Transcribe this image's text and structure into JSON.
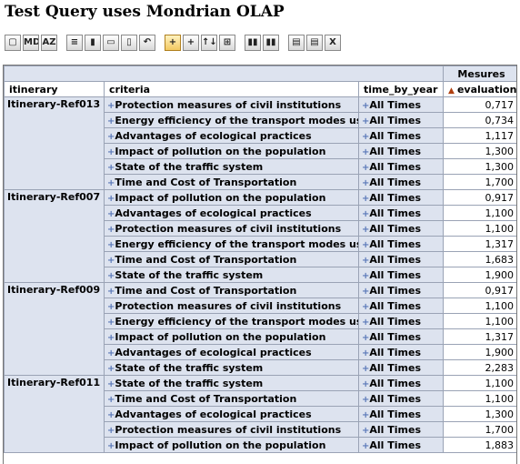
{
  "page": {
    "title": "Test Query uses Mondrian OLAP"
  },
  "toolbar": [
    {
      "name": "olap-navigator-button",
      "glyph": "▢"
    },
    {
      "name": "mdx-button",
      "glyph": "MDX"
    },
    {
      "name": "sort-az-button",
      "glyph": "AZ"
    },
    {
      "name": "show-parent-button",
      "glyph": "≡"
    },
    {
      "name": "show-children-button",
      "glyph": "▮"
    },
    {
      "name": "hide-empty-button",
      "glyph": "▭"
    },
    {
      "name": "suppress-button",
      "glyph": "▯"
    },
    {
      "name": "swap-axes-button",
      "glyph": "↶"
    },
    {
      "name": "drill-member-button",
      "glyph": "+−",
      "active": true
    },
    {
      "name": "drill-position-button",
      "glyph": "+−"
    },
    {
      "name": "drill-replace-button",
      "glyph": "↑↓"
    },
    {
      "name": "drill-through-button",
      "glyph": "⊞"
    },
    {
      "name": "show-chart-button",
      "glyph": "▮▮"
    },
    {
      "name": "chart-config-button",
      "glyph": "▮▮"
    },
    {
      "name": "print-config-button",
      "glyph": "▤"
    },
    {
      "name": "print-pdf-button",
      "glyph": "▤"
    },
    {
      "name": "export-excel-button",
      "glyph": "X"
    }
  ],
  "table": {
    "measures_header": "Mesures",
    "columns": {
      "itinerary": "itinerary",
      "criteria": "criteria",
      "time": "time_by_year",
      "evaluation": "evaluation"
    },
    "sort_indicator": "▲",
    "expand_glyph": "+",
    "groups": [
      {
        "itinerary": "Itinerary-Ref013",
        "rows": [
          {
            "criteria": "Protection measures of civil institutions",
            "time": "All Times",
            "value": "0,717"
          },
          {
            "criteria": "Energy efficiency of the transport modes used",
            "time": "All Times",
            "value": "0,734"
          },
          {
            "criteria": "Advantages of ecological practices",
            "time": "All Times",
            "value": "1,117"
          },
          {
            "criteria": "Impact of pollution on the population",
            "time": "All Times",
            "value": "1,300"
          },
          {
            "criteria": "State of the traffic system",
            "time": "All Times",
            "value": "1,300"
          },
          {
            "criteria": "Time and Cost of Transportation",
            "time": "All Times",
            "value": "1,700"
          }
        ]
      },
      {
        "itinerary": "Itinerary-Ref007",
        "rows": [
          {
            "criteria": "Impact of pollution on the population",
            "time": "All Times",
            "value": "0,917"
          },
          {
            "criteria": "Advantages of ecological practices",
            "time": "All Times",
            "value": "1,100"
          },
          {
            "criteria": "Protection measures of civil institutions",
            "time": "All Times",
            "value": "1,100"
          },
          {
            "criteria": "Energy efficiency of the transport modes used",
            "time": "All Times",
            "value": "1,317"
          },
          {
            "criteria": "Time and Cost of Transportation",
            "time": "All Times",
            "value": "1,683"
          },
          {
            "criteria": "State of the traffic system",
            "time": "All Times",
            "value": "1,900"
          }
        ]
      },
      {
        "itinerary": "Itinerary-Ref009",
        "rows": [
          {
            "criteria": "Time and Cost of Transportation",
            "time": "All Times",
            "value": "0,917"
          },
          {
            "criteria": "Protection measures of civil institutions",
            "time": "All Times",
            "value": "1,100"
          },
          {
            "criteria": "Energy efficiency of the transport modes used",
            "time": "All Times",
            "value": "1,100"
          },
          {
            "criteria": "Impact of pollution on the population",
            "time": "All Times",
            "value": "1,317"
          },
          {
            "criteria": "Advantages of ecological practices",
            "time": "All Times",
            "value": "1,900"
          },
          {
            "criteria": "State of the traffic system",
            "time": "All Times",
            "value": "2,283"
          }
        ]
      },
      {
        "itinerary": "Itinerary-Ref011",
        "rows": [
          {
            "criteria": "State of the traffic system",
            "time": "All Times",
            "value": "1,100"
          },
          {
            "criteria": "Time and Cost of Transportation",
            "time": "All Times",
            "value": "1,100"
          },
          {
            "criteria": "Advantages of ecological practices",
            "time": "All Times",
            "value": "1,300"
          },
          {
            "criteria": "Protection measures of civil institutions",
            "time": "All Times",
            "value": "1,700"
          },
          {
            "criteria": "Impact of pollution on the population",
            "time": "All Times",
            "value": "1,883"
          }
        ]
      }
    ]
  }
}
